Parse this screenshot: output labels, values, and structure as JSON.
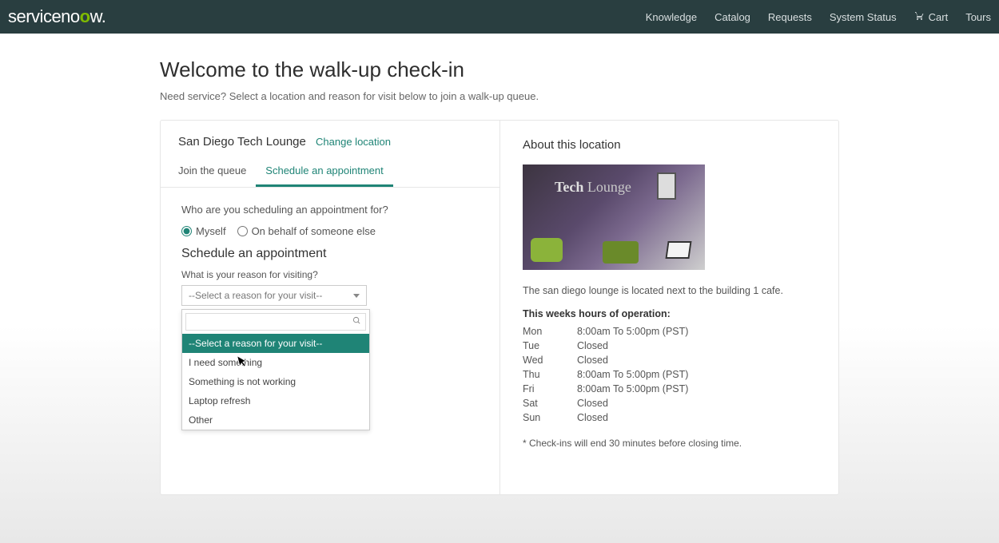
{
  "brand": {
    "part1": "serviceno",
    "o": "o",
    "part2": "w."
  },
  "topnav": {
    "knowledge": "Knowledge",
    "catalog": "Catalog",
    "requests": "Requests",
    "system_status": "System Status",
    "cart": "Cart",
    "tours": "Tours"
  },
  "page": {
    "title": "Welcome to the walk-up check-in",
    "subtitle": "Need service? Select a location and reason for visit below to join a walk-up queue."
  },
  "location": {
    "name": "San Diego Tech Lounge",
    "change": "Change location"
  },
  "tabs": {
    "join": "Join the queue",
    "schedule": "Schedule an appointment"
  },
  "form": {
    "who_label": "Who are you scheduling an appointment for?",
    "myself": "Myself",
    "on_behalf": "On behalf of someone else",
    "section_title": "Schedule an appointment",
    "reason_label": "What is your reason for visiting?",
    "select_placeholder": "--Select a reason for your visit--",
    "search_value": "",
    "options": {
      "placeholder": "--Select a reason for your visit--",
      "opt1": "I need something",
      "opt2": "Something is not working",
      "opt3": "Laptop refresh",
      "opt4": "Other"
    }
  },
  "about": {
    "title": "About this location",
    "photo_sign_a": "Tech",
    "photo_sign_b": " Lounge",
    "desc": "The san diego lounge is located next to the building 1 cafe.",
    "hours_title": "This weeks hours of operation:",
    "hours": {
      "mon": {
        "day": "Mon",
        "time": "8:00am To 5:00pm (PST)"
      },
      "tue": {
        "day": "Tue",
        "time": "Closed"
      },
      "wed": {
        "day": "Wed",
        "time": "Closed"
      },
      "thu": {
        "day": "Thu",
        "time": "8:00am To 5:00pm (PST)"
      },
      "fri": {
        "day": "Fri",
        "time": "8:00am To 5:00pm (PST)"
      },
      "sat": {
        "day": "Sat",
        "time": "Closed"
      },
      "sun": {
        "day": "Sun",
        "time": "Closed"
      }
    },
    "footnote": "* Check-ins will end 30 minutes before closing time."
  }
}
